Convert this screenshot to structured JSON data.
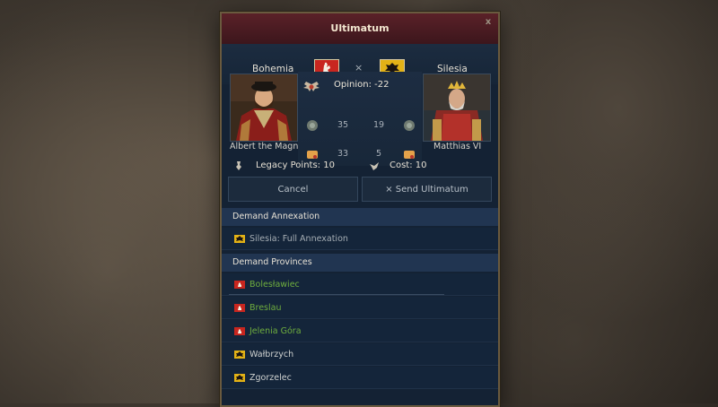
{
  "window": {
    "title": "Ultimatum",
    "close_label": "x"
  },
  "header": {
    "left_country": "Bohemia",
    "right_country": "Silesia",
    "versus": "×"
  },
  "rulers": {
    "left_name": "Albert the Magn…",
    "right_name": "Matthias VI"
  },
  "relations": {
    "opinion": "Opinion: -22",
    "stat_rows": [
      {
        "left": "35",
        "right": "19",
        "icon": "army-shield-icon"
      },
      {
        "left": "33",
        "right": "5",
        "icon": "scroll-icon"
      }
    ]
  },
  "points": {
    "legacy": "Legacy Points: 10",
    "cost": "Cost: 10"
  },
  "buttons": {
    "cancel": "Cancel",
    "send": "× Send Ultimatum"
  },
  "annexation": {
    "header": "Demand Annexation",
    "items": [
      {
        "label": "Silesia: Full Annexation"
      }
    ]
  },
  "provinces": {
    "header": "Demand Provinces",
    "items": [
      {
        "label": "Bolesławiec",
        "owner": "bohemia"
      },
      {
        "label": "Breslau",
        "owner": "bohemia"
      },
      {
        "label": "Jelenia Góra",
        "owner": "bohemia"
      },
      {
        "label": "Wałbrzych",
        "owner": "silesia"
      },
      {
        "label": "Zgorzelec",
        "owner": "silesia"
      }
    ]
  },
  "colors": {
    "bohemia_flag": "#c8261f",
    "silesia_flag": "#e3b216",
    "available_province": "#6fae3e",
    "title_bar": "#5a2128",
    "panel_bg": "#142234"
  }
}
